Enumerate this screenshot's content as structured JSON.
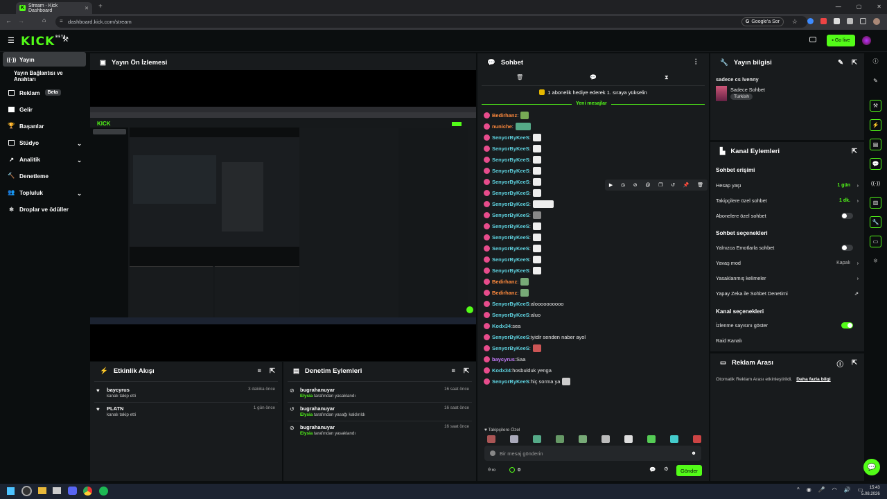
{
  "browser": {
    "tab_title": "Stream - Kick Dashboard",
    "url": "dashboard.kick.com/stream",
    "google_chip": "Google'a Sor"
  },
  "header": {
    "logo": "KICK",
    "beta": "BETA",
    "go_live": "Go live"
  },
  "sidebar": {
    "items": [
      {
        "label": "Yayın"
      },
      {
        "label": "Yayın Bağlantısı ve Anahtarı"
      },
      {
        "label": "Reklam",
        "badge": "Beta"
      },
      {
        "label": "Gelir"
      },
      {
        "label": "Başarılar"
      },
      {
        "label": "Stüdyo"
      },
      {
        "label": "Analitik"
      },
      {
        "label": "Denetleme"
      },
      {
        "label": "Topluluk"
      },
      {
        "label": "Droplar ve ödüller"
      }
    ]
  },
  "preview": {
    "title": "Yayın Ön İzlemesi"
  },
  "activity": {
    "title": "Etkinlik Akışı",
    "rows": [
      {
        "name": "baycyrus",
        "desc": "kanalı takip etti",
        "time": "3 dakika önce"
      },
      {
        "name": "PLATN",
        "desc": "kanalı takip etti",
        "time": "1 gün önce"
      }
    ]
  },
  "moderation": {
    "title": "Denetim Eylemleri",
    "rows": [
      {
        "name": "bugrahanuyar",
        "actor": "Elysia",
        "desc": "tarafından yasaklandı",
        "time": "16 saat önce"
      },
      {
        "name": "bugrahanuyar",
        "actor": "Elysia",
        "desc": "tarafından yasağı kaldırıldı",
        "time": "16 saat önce"
      },
      {
        "name": "bugrahanuyar",
        "actor": "Elysia",
        "desc": "tarafından yasaklandı",
        "time": "16 saat önce"
      }
    ]
  },
  "chat": {
    "title": "Sohbet",
    "goal": "1 abonelik hediye ederek 1. sıraya yükselin",
    "new_messages": "Yeni mesajlar",
    "messages": [
      {
        "user": "Bedirhanz",
        "color": "#ff8a3d",
        "text": ""
      },
      {
        "user": "nuniche",
        "color": "#ff8a3d",
        "text": ""
      },
      {
        "user": "SenyorByKeeS",
        "color": "#5fd3e0",
        "text": ""
      },
      {
        "user": "SenyorByKeeS",
        "color": "#5fd3e0",
        "text": ""
      },
      {
        "user": "SenyorByKeeS",
        "color": "#5fd3e0",
        "text": ""
      },
      {
        "user": "SenyorByKeeS",
        "color": "#5fd3e0",
        "text": ""
      },
      {
        "user": "SenyorByKeeS",
        "color": "#5fd3e0",
        "text": ""
      },
      {
        "user": "SenyorByKeeS",
        "color": "#5fd3e0",
        "text": ""
      },
      {
        "user": "SenyorByKeeS",
        "color": "#5fd3e0",
        "text": ""
      },
      {
        "user": "SenyorByKeeS",
        "color": "#5fd3e0",
        "text": ""
      },
      {
        "user": "SenyorByKeeS",
        "color": "#5fd3e0",
        "text": ""
      },
      {
        "user": "SenyorByKeeS",
        "color": "#5fd3e0",
        "text": ""
      },
      {
        "user": "SenyorByKeeS",
        "color": "#5fd3e0",
        "text": ""
      },
      {
        "user": "SenyorByKeeS",
        "color": "#5fd3e0",
        "text": ""
      },
      {
        "user": "SenyorByKeeS",
        "color": "#5fd3e0",
        "text": ""
      },
      {
        "user": "Bedirhanz",
        "color": "#ff8a3d",
        "text": ""
      },
      {
        "user": "Bedirhanz",
        "color": "#ff8a3d",
        "text": ""
      },
      {
        "user": "SenyorByKeeS",
        "color": "#5fd3e0",
        "text": "aloooooooooo"
      },
      {
        "user": "SenyorByKeeS",
        "color": "#5fd3e0",
        "text": "aluo"
      },
      {
        "user": "Kodx34",
        "color": "#5fd3e0",
        "text": "sea"
      },
      {
        "user": "SenyorByKeeS",
        "color": "#5fd3e0",
        "text": "iyidir senden naber ayol"
      },
      {
        "user": "SenyorByKeeS",
        "color": "#5fd3e0",
        "text": ""
      },
      {
        "user": "baycyrus",
        "color": "#c77dff",
        "text": "Saa"
      },
      {
        "user": "Kodx34",
        "color": "#5fd3e0",
        "text": "hosbulduk yenga"
      },
      {
        "user": "SenyorByKeeS",
        "color": "#5fd3e0",
        "text": "hiç sorma ya"
      }
    ],
    "followers_only": "Takipçilere Özel",
    "input_placeholder": "Bir mesaj gönderin",
    "count": "0",
    "send": "Gönder"
  },
  "stream_info": {
    "title": "Yayın bilgisi",
    "stream_title": "sadece cs lvenny",
    "category": "Sadece Sohbet",
    "language": "Turkish"
  },
  "channel_actions": {
    "title": "Kanal Eylemleri",
    "chat_access": "Sohbet erişimi",
    "account_age": "Hesap yaşı",
    "account_age_value": "1 gün",
    "followers_chat": "Takipçilere özel sohbet",
    "followers_chat_value": "1 dk.",
    "subs_chat": "Abonelere özel sohbet",
    "chat_options": "Sohbet seçenekleri",
    "emotes_only": "Yalnızca Emotlarla sohbet",
    "slow_mode": "Yavaş mod",
    "slow_mode_value": "Kapalı",
    "banned_words": "Yasaklanmış kelimeler",
    "ai_moderation": "Yapay Zeka ile Sohbet Denetimi",
    "channel_options": "Kanal seçenekleri",
    "show_viewers": "İzlenme sayısını göster",
    "raid": "Raid Kanalı"
  },
  "ad_break": {
    "title": "Reklam Arası",
    "text": "Otomatik Reklam Arası etkinleştirildi.",
    "link": "Daha fazla bilgi"
  },
  "taskbar": {
    "time": "15:43",
    "date": "5.08.2026"
  },
  "colors": {
    "accent": "#53fc18",
    "panel": "#181b1d",
    "bg": "#0b0e0f"
  }
}
